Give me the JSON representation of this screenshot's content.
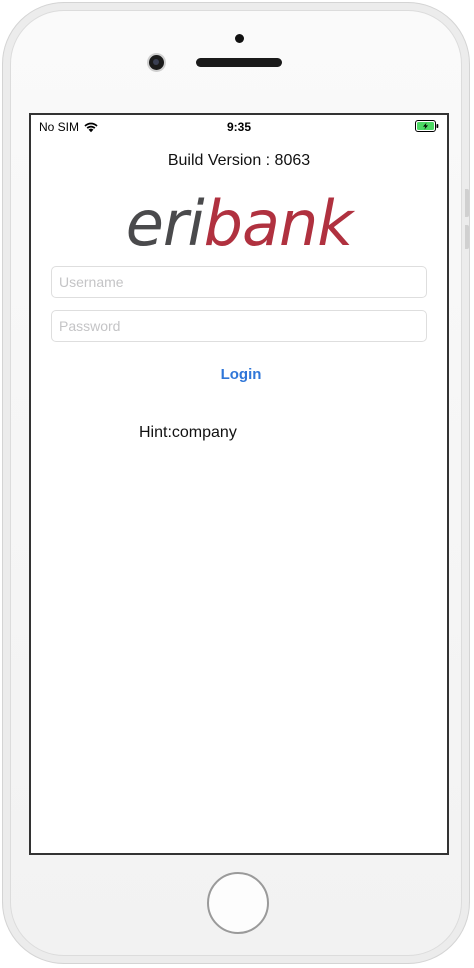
{
  "status_bar": {
    "carrier": "No SIM",
    "time": "9:35",
    "wifi_icon": "wifi-icon",
    "battery_icon": "battery-charging-icon"
  },
  "build_version": "Build Version : 8063",
  "logo": {
    "part1": "eri",
    "part2": "bank",
    "colors": {
      "part1": "#4a4a4c",
      "part2": "#b0313f"
    }
  },
  "login_form": {
    "username": {
      "placeholder": "Username",
      "value": ""
    },
    "password": {
      "placeholder": "Password",
      "value": ""
    },
    "login_label": "Login"
  },
  "hint": "Hint:company",
  "colors": {
    "accent": "#2f76d8",
    "battery_charge": "#4cd964"
  }
}
